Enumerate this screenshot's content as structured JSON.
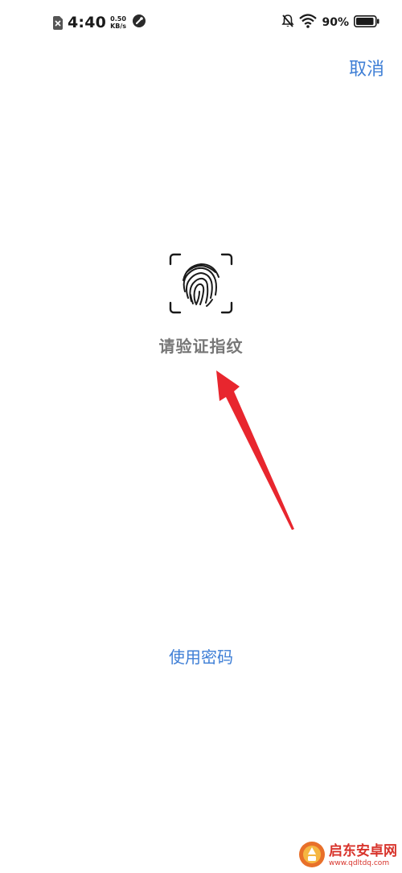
{
  "status_bar": {
    "time": "4:40",
    "speed_value": "0.50",
    "speed_unit": "KB/s",
    "battery_percent": "90%"
  },
  "header": {
    "cancel_label": "取消"
  },
  "fingerprint": {
    "prompt": "请验证指纹"
  },
  "footer": {
    "use_password_label": "使用密码"
  },
  "watermark": {
    "brand": "启东安卓网",
    "url": "www.qdltdq.com"
  },
  "colors": {
    "accent": "#3f7fd6",
    "prompt_text": "#777777",
    "arrow": "#e8262e",
    "watermark": "#d8342c"
  },
  "icons": [
    "sim-off-icon",
    "app-badge-icon",
    "mute-icon",
    "wifi-icon",
    "battery-icon",
    "fingerprint-icon",
    "arrow-icon",
    "watermark-logo-icon"
  ]
}
